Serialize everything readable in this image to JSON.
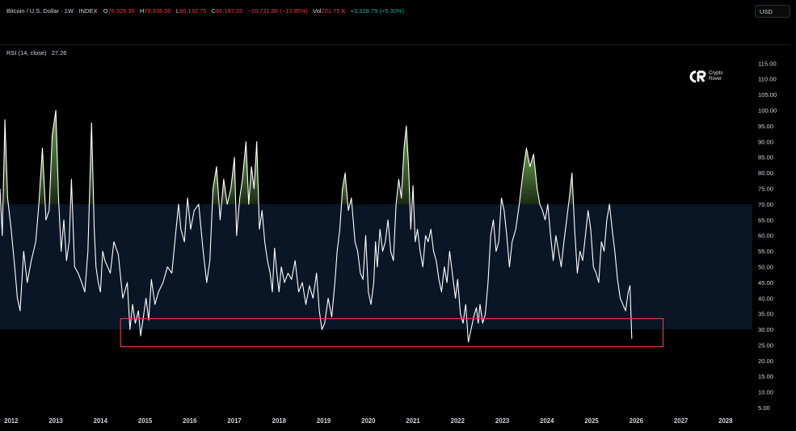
{
  "header": {
    "symbol": "Bitcoin / U.S. Dollar · 1W · INDEX",
    "o_label": "O",
    "o_value": "76,926.35",
    "h_label": "H",
    "h_value": "79,335.00",
    "l_label": "L",
    "l_value": "60,132.75",
    "c_label": "C",
    "c_value": "66,187.32",
    "change": "−10,731.86 (−13.95%)",
    "vol_label": "Vol",
    "vol_value": "201.75 K",
    "vol_change": "+3,328.79 (+5.30%)",
    "currency": "USD"
  },
  "indicator": {
    "name": "RSI (14, close)",
    "value": "27.26"
  },
  "logo": {
    "line1": "Crypto",
    "line2": "Rover"
  },
  "colors": {
    "rsi_line": "#ffffff",
    "band_fill": "#0a1526",
    "overbought_fill": "#6aa84f",
    "highlight_box": "#e03a3a",
    "up": "#22ab94",
    "down": "#f23645"
  },
  "chart_data": {
    "type": "line",
    "title": "RSI (14, close)",
    "xlabel": "",
    "ylabel": "",
    "xlim": [
      2011.75,
      2028.6
    ],
    "ylim": [
      3,
      119
    ],
    "y_ticks": [
      "5.00",
      "10.00",
      "15.00",
      "20.00",
      "25.00",
      "30.00",
      "35.00",
      "40.00",
      "45.00",
      "50.00",
      "55.00",
      "60.00",
      "65.00",
      "70.00",
      "75.00",
      "80.00",
      "85.00",
      "90.00",
      "95.00",
      "100.00",
      "105.00",
      "110.00",
      "115.00"
    ],
    "x_ticks": [
      "2012",
      "2013",
      "2014",
      "2015",
      "2016",
      "2017",
      "2018",
      "2019",
      "2020",
      "2021",
      "2022",
      "2023",
      "2024",
      "2025",
      "2026",
      "2027",
      "2028"
    ],
    "band": [
      30,
      70
    ],
    "highlight": {
      "x": [
        2014.45,
        2026.6
      ],
      "y": [
        24.5,
        33.5
      ]
    },
    "grid": false,
    "x": [
      2011.75,
      2011.8,
      2011.86,
      2011.92,
      2012.0,
      2012.08,
      2012.14,
      2012.2,
      2012.28,
      2012.36,
      2012.45,
      2012.55,
      2012.62,
      2012.7,
      2012.78,
      2012.85,
      2012.92,
      2013.0,
      2013.06,
      2013.12,
      2013.18,
      2013.24,
      2013.3,
      2013.35,
      2013.42,
      2013.5,
      2013.58,
      2013.65,
      2013.72,
      2013.8,
      2013.86,
      2013.9,
      2013.95,
      2014.0,
      2014.05,
      2014.1,
      2014.16,
      2014.22,
      2014.3,
      2014.4,
      2014.5,
      2014.6,
      2014.66,
      2014.72,
      2014.78,
      2014.85,
      2014.9,
      2014.96,
      2015.02,
      2015.08,
      2015.14,
      2015.22,
      2015.3,
      2015.4,
      2015.5,
      2015.6,
      2015.68,
      2015.75,
      2015.8,
      2015.88,
      2015.95,
      2016.02,
      2016.1,
      2016.2,
      2016.3,
      2016.38,
      2016.45,
      2016.52,
      2016.6,
      2016.68,
      2016.76,
      2016.84,
      2016.92,
      2017.0,
      2017.05,
      2017.12,
      2017.18,
      2017.26,
      2017.32,
      2017.38,
      2017.44,
      2017.5,
      2017.56,
      2017.62,
      2017.68,
      2017.74,
      2017.8,
      2017.85,
      2017.9,
      2017.95,
      2018.0,
      2018.05,
      2018.12,
      2018.2,
      2018.28,
      2018.36,
      2018.44,
      2018.52,
      2018.6,
      2018.68,
      2018.76,
      2018.84,
      2018.9,
      2018.96,
      2019.02,
      2019.1,
      2019.18,
      2019.25,
      2019.3,
      2019.36,
      2019.42,
      2019.48,
      2019.55,
      2019.62,
      2019.7,
      2019.76,
      2019.82,
      2019.88,
      2019.94,
      2020.0,
      2020.06,
      2020.12,
      2020.16,
      2020.2,
      2020.26,
      2020.32,
      2020.38,
      2020.44,
      2020.5,
      2020.56,
      2020.62,
      2020.68,
      2020.74,
      2020.8,
      2020.85,
      2020.9,
      2020.95,
      2021.0,
      2021.05,
      2021.1,
      2021.16,
      2021.22,
      2021.28,
      2021.34,
      2021.4,
      2021.46,
      2021.52,
      2021.58,
      2021.64,
      2021.7,
      2021.76,
      2021.82,
      2021.88,
      2021.95,
      2022.0,
      2022.06,
      2022.12,
      2022.18,
      2022.24,
      2022.3,
      2022.36,
      2022.42,
      2022.46,
      2022.5,
      2022.56,
      2022.62,
      2022.68,
      2022.74,
      2022.8,
      2022.86,
      2022.92,
      2022.98,
      2023.04,
      2023.1,
      2023.16,
      2023.22,
      2023.3,
      2023.38,
      2023.46,
      2023.54,
      2023.62,
      2023.7,
      2023.78,
      2023.84,
      2023.9,
      2023.96,
      2024.02,
      2024.08,
      2024.14,
      2024.2,
      2024.26,
      2024.32,
      2024.38,
      2024.44,
      2024.5,
      2024.56,
      2024.62,
      2024.68,
      2024.74,
      2024.8,
      2024.86,
      2024.92,
      2024.98,
      2025.04,
      2025.1,
      2025.16,
      2025.22,
      2025.28,
      2025.34,
      2025.4,
      2025.46,
      2025.52,
      2025.58,
      2025.64,
      2025.7,
      2025.76,
      2025.82,
      2025.86,
      2025.9,
      2025.94,
      2025.98,
      2026.02,
      2026.05
    ],
    "values": [
      75,
      60,
      97,
      72,
      62,
      50,
      40,
      36,
      55,
      45,
      52,
      58,
      70,
      88,
      65,
      68,
      92,
      100,
      72,
      55,
      65,
      52,
      58,
      78,
      50,
      48,
      45,
      42,
      55,
      96,
      62,
      50,
      45,
      42,
      55,
      52,
      50,
      48,
      58,
      54,
      40,
      45,
      30,
      38,
      32,
      36,
      28,
      34,
      40,
      33,
      46,
      38,
      42,
      45,
      50,
      48,
      60,
      70,
      62,
      58,
      72,
      62,
      68,
      70,
      55,
      45,
      52,
      75,
      82,
      65,
      78,
      70,
      75,
      85,
      60,
      72,
      78,
      90,
      70,
      82,
      75,
      90,
      62,
      68,
      58,
      52,
      48,
      42,
      56,
      48,
      42,
      50,
      45,
      48,
      46,
      52,
      42,
      45,
      38,
      44,
      40,
      48,
      36,
      30,
      32,
      40,
      34,
      45,
      55,
      62,
      75,
      80,
      68,
      72,
      58,
      55,
      48,
      46,
      60,
      42,
      38,
      45,
      58,
      50,
      62,
      55,
      58,
      65,
      55,
      52,
      70,
      78,
      72,
      88,
      95,
      82,
      62,
      76,
      58,
      62,
      55,
      50,
      60,
      58,
      62,
      55,
      52,
      46,
      42,
      50,
      45,
      55,
      48,
      40,
      46,
      35,
      32,
      38,
      26,
      30,
      34,
      37,
      32,
      38,
      32,
      35,
      45,
      60,
      65,
      55,
      58,
      72,
      68,
      60,
      50,
      58,
      62,
      70,
      80,
      88,
      82,
      86,
      75,
      70,
      68,
      65,
      70,
      60,
      52,
      60,
      55,
      50,
      58,
      65,
      72,
      80,
      62,
      48,
      55,
      52,
      60,
      68,
      62,
      50,
      48,
      45,
      58,
      55,
      65,
      70,
      62,
      55,
      46,
      40,
      38,
      36,
      42,
      44,
      27
    ]
  }
}
